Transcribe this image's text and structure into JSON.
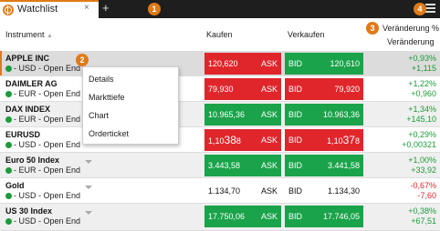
{
  "window": {
    "tab_title": "Watchlist",
    "tab_close": "×",
    "tab_add": "+",
    "accent": "#e07a16",
    "menu_icon": "hamburger-icon"
  },
  "badges": [
    "1",
    "2",
    "3",
    "4"
  ],
  "header": {
    "instrument": "Instrument",
    "sort_arrow": "▲",
    "buy": "Kaufen",
    "sell": "Verkaufen",
    "change_pct": "Veränderung %",
    "change": "Veränderung"
  },
  "colors": {
    "up": "#1aa34a",
    "down": "#e0262b"
  },
  "rows": [
    {
      "name": "APPLE INC",
      "sub": "- USD - Open End",
      "bid": "120,620",
      "bid_label": "ASK",
      "ask_label": "BID",
      "ask": "120,610",
      "chg_pct": "+0,93%",
      "chg": "+1,115",
      "bid_color": "red",
      "ask_color": "green",
      "dir": "pos"
    },
    {
      "name": "DAIMLER AG",
      "sub": "- EUR - Open End",
      "bid": "79,930",
      "bid_label": "ASK",
      "ask_label": "BID",
      "ask": "79,920",
      "chg_pct": "+1,22%",
      "chg": "+0,960",
      "bid_color": "red",
      "ask_color": "red",
      "dir": "pos"
    },
    {
      "name": "DAX INDEX",
      "sub": "- EUR - Open End",
      "bid": "10.965,36",
      "bid_label": "ASK",
      "ask_label": "BID",
      "ask": "10.963,36",
      "chg_pct": "+1,34%",
      "chg": "+145,10",
      "bid_color": "green",
      "ask_color": "green",
      "dir": "pos"
    },
    {
      "name": "EURUSD",
      "sub": "- USD - Open End",
      "bid_main": "1,10",
      "bid_big": "38",
      "bid_tail": "8",
      "bid_label": "ASK",
      "ask_label": "BID",
      "ask_main": "1,10",
      "ask_big": "37",
      "ask_tail": "8",
      "chg_pct": "+0,29%",
      "chg": "+0,00321",
      "bid_color": "red",
      "ask_color": "red",
      "dir": "pos"
    },
    {
      "name": "Euro 50 Index",
      "sub": "- EUR - Open End",
      "bid": "3.443,58",
      "bid_label": "ASK",
      "ask_label": "BID",
      "ask": "3.441,58",
      "chg_pct": "+1,00%",
      "chg": "+33,92",
      "bid_color": "green",
      "ask_color": "green",
      "dir": "pos"
    },
    {
      "name": "Gold",
      "sub": "- USD - Open End",
      "bid": "1.134,70",
      "bid_label": "ASK",
      "ask_label": "BID",
      "ask": "1.134,30",
      "chg_pct": "-0,67%",
      "chg": "-7,60",
      "bid_color": "plain",
      "ask_color": "plain",
      "dir": "neg"
    },
    {
      "name": "US 30 Index",
      "sub": "- USD - Open End",
      "bid": "17.750,06",
      "bid_label": "ASK",
      "ask_label": "BID",
      "ask": "17.746,05",
      "chg_pct": "+0,38%",
      "chg": "+67,51",
      "bid_color": "green",
      "ask_color": "green",
      "dir": "pos"
    }
  ],
  "context_menu": [
    "Details",
    "Markttiefe",
    "Chart",
    "Orderticket"
  ]
}
